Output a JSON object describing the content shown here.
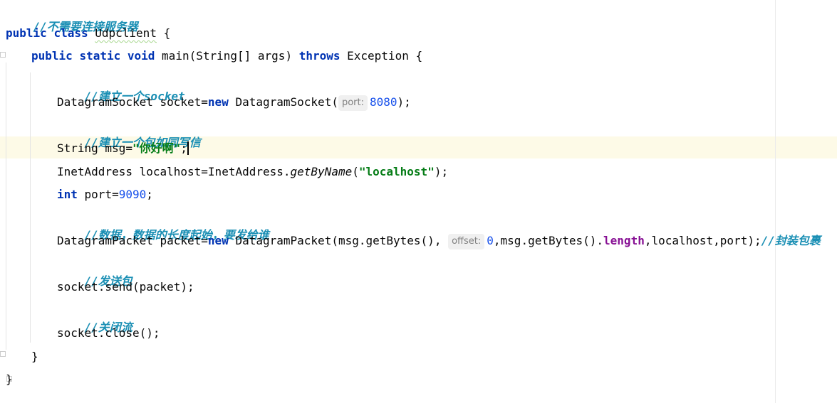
{
  "code": {
    "comment_no_server": "//不需要连接服务器",
    "kw_public": "public",
    "kw_class": "class",
    "class_name": "Udpclient",
    "brace_open": " {",
    "kw_static": "static",
    "kw_void": "void",
    "main_signature": "main(String[] args) ",
    "kw_throws": "throws",
    "exception_text": " Exception {",
    "comment_socket": "//建立一个socket",
    "socket_decl_prefix": "DatagramSocket socket=",
    "kw_new": "new",
    "socket_ctor": " DatagramSocket(",
    "hint_port": "port:",
    "num_8080": "8080",
    "close_paren_semi": ");",
    "comment_packet": "//建立一个包如同写信",
    "msg_decl_prefix": "String msg=",
    "msg_value": "\"你好啊\"",
    "semicolon": ";",
    "inet_decl": "InetAddress localhost=InetAddress.",
    "inet_method": "getByName",
    "paren_open": "(",
    "localhost_string": "\"localhost\"",
    "kw_int": "int",
    "port_decl": " port=",
    "num_9090": "9090",
    "comment_data": "//数据，数据的长度起始，要发给谁",
    "packet_decl_prefix": "DatagramPacket packet=",
    "packet_ctor": " DatagramPacket(msg.getBytes(),",
    "hint_offset": "offset:",
    "num_0": "0",
    "packet_mid": ",msg.getBytes().",
    "field_length": "length",
    "packet_tail": ",localhost,port);",
    "comment_wrap": "//封装包裹",
    "comment_send": "//发送包",
    "send_stmt": "socket.send(packet);",
    "comment_close": "//关闭流",
    "close_stmt": "socket.close();",
    "brace_close": "}"
  },
  "colors": {
    "keyword": "#0033b3",
    "comment": "#1a8fb4",
    "string": "#067d17",
    "number": "#1750eb",
    "field": "#871094",
    "current_line": "#fdfae7"
  }
}
